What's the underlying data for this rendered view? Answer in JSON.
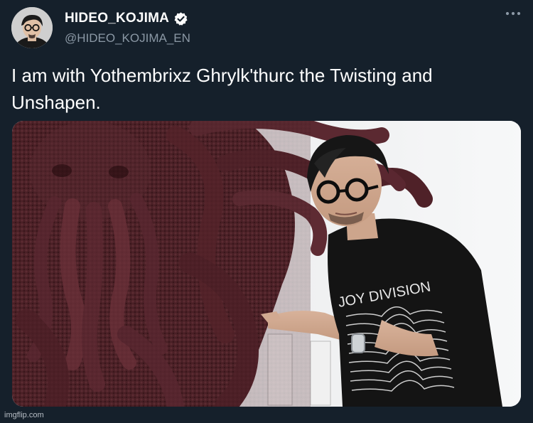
{
  "author": {
    "display_name": "HIDEO_KOJIMA",
    "handle": "@HIDEO_KOJIMA_EN",
    "verified": true
  },
  "tweet": {
    "text": "I am with Yothembrixz Ghrylk'thurc the Twisting and Unshapen."
  },
  "media": {
    "shirt_text": "JOY DIVISION"
  },
  "watermark": "imgflip.com",
  "icons": {
    "verified": "verified-badge-icon",
    "more": "more-options-icon"
  },
  "colors": {
    "background": "#15202b",
    "text": "#ffffff",
    "secondary_text": "#8b98a5"
  }
}
